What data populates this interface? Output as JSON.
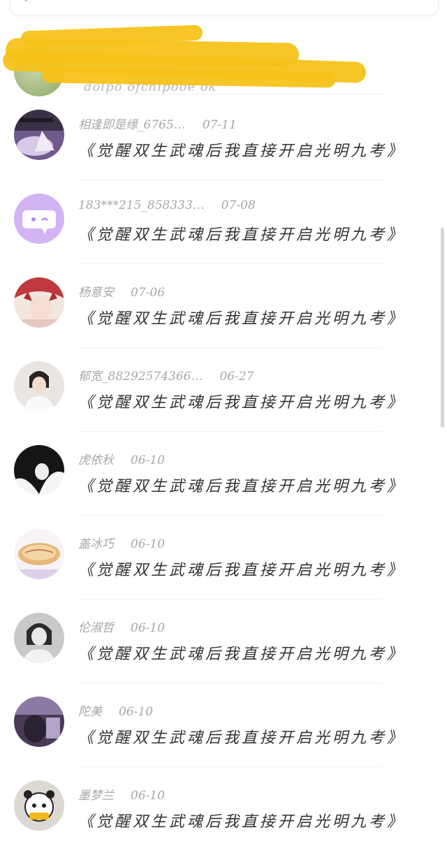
{
  "redacted": {
    "text": "dolpo ofchipooe ok"
  },
  "items": [
    {
      "name": "相逢即是缘_6765…",
      "date": "07-11",
      "book": "《觉醒双生武魂后我直接开启光明九考》",
      "avatar": "purple-scene-avatar"
    },
    {
      "name": "183***215_858333…",
      "date": "07-08",
      "book": "《觉醒双生武魂后我直接开启光明九考》",
      "avatar": "chat-bubble-avatar"
    },
    {
      "name": "杨意安",
      "date": "07-06",
      "book": "《觉醒双生武魂后我直接开启光明九考》",
      "avatar": "fox-girl-avatar"
    },
    {
      "name": "郁宽_88292574366…",
      "date": "06-27",
      "book": "《觉醒双生武魂后我直接开启光明九考》",
      "avatar": "girl-portrait-avatar"
    },
    {
      "name": "虎依秋",
      "date": "06-10",
      "book": "《觉醒双生武魂后我直接开启光明九考》",
      "avatar": "bw-girl-avatar"
    },
    {
      "name": "盖冰巧",
      "date": "06-10",
      "book": "《觉醒双生武魂后我直接开启光明九考》",
      "avatar": "pancake-avatar"
    },
    {
      "name": "伦淑哲",
      "date": "06-10",
      "book": "《觉醒双生武魂后我直接开启光明九考》",
      "avatar": "gray-portrait-avatar"
    },
    {
      "name": "陀美",
      "date": "06-10",
      "book": "《觉醒双生武魂后我直接开启光明九考》",
      "avatar": "dark-photo-avatar"
    },
    {
      "name": "墨梦兰",
      "date": "06-10",
      "book": "《觉醒双生武魂后我直接开启光明九考》",
      "avatar": "panda-cartoon-avatar"
    }
  ],
  "colors": {
    "name_text": "#a7a7a7",
    "title_text": "#333333",
    "redaction": "#f6c21a"
  }
}
